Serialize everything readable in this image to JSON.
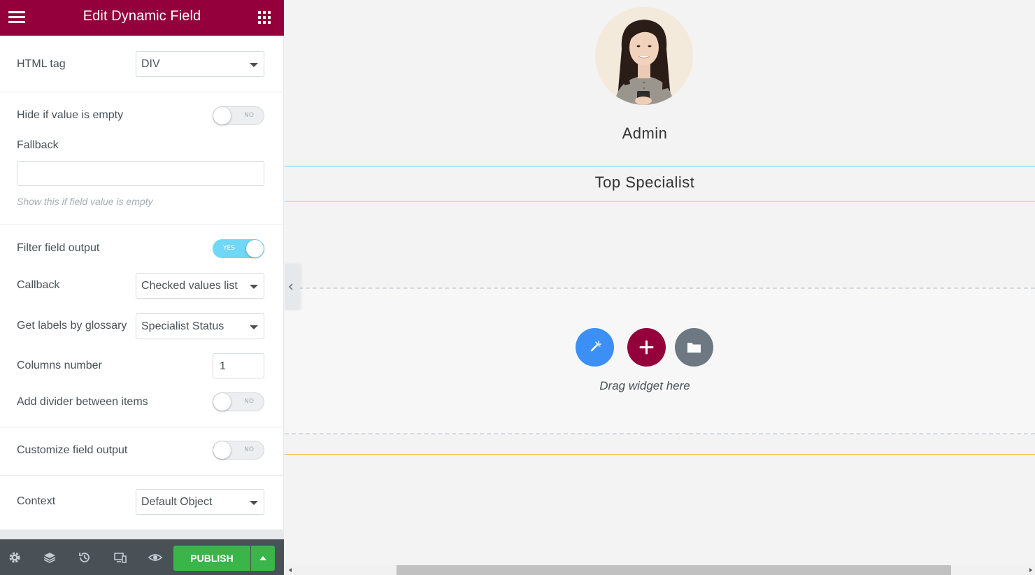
{
  "panel": {
    "title": "Edit Dynamic Field",
    "html_tag": {
      "label": "HTML tag",
      "value": "DIV"
    },
    "hide_if_empty": {
      "label": "Hide if value is empty",
      "state": "NO"
    },
    "fallback": {
      "label": "Fallback",
      "value": "",
      "hint": "Show this if field value is empty"
    },
    "filter_output": {
      "label": "Filter field output",
      "state": "YES"
    },
    "callback": {
      "label": "Callback",
      "value": "Checked values list"
    },
    "glossary": {
      "label": "Get labels by glossary",
      "value": "Specialist Status"
    },
    "columns": {
      "label": "Columns number",
      "value": "1"
    },
    "add_divider": {
      "label": "Add divider between items",
      "state": "NO"
    },
    "customize_output": {
      "label": "Customize field output",
      "state": "NO"
    },
    "context": {
      "label": "Context",
      "value": "Default Object"
    }
  },
  "footer": {
    "icons": [
      "settings-icon",
      "layers-icon",
      "history-icon",
      "responsive-icon",
      "preview-icon"
    ],
    "publish_label": "PUBLISH"
  },
  "canvas": {
    "admin_name": "Admin",
    "section_title": "Top Specialist",
    "drag_hint": "Drag widget here",
    "buttons": [
      "magic-icon",
      "add-icon",
      "folder-icon"
    ]
  },
  "colors": {
    "brand": "#93003c",
    "toggle_on": "#71d7f7",
    "publish": "#39b54a",
    "ai_button": "#3b8ff5",
    "template_button": "#6d7882",
    "section_border": "#71d7f7",
    "accent_line": "#f0c23c"
  }
}
